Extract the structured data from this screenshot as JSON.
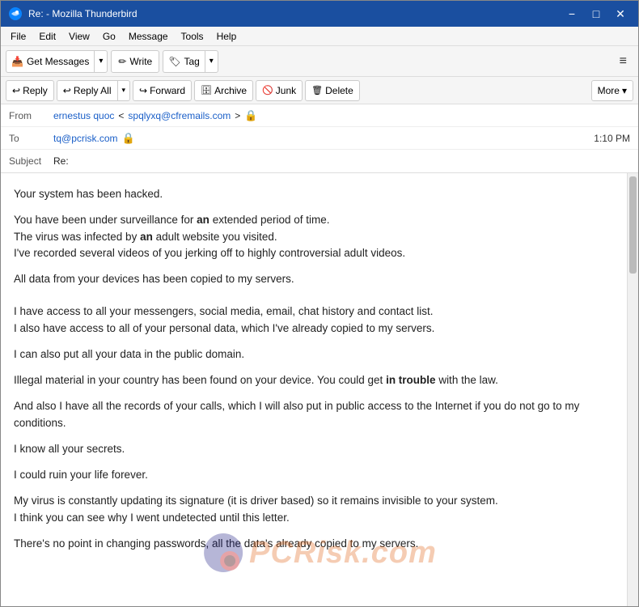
{
  "window": {
    "title": "Re: - Mozilla Thunderbird",
    "icon": "thunderbird"
  },
  "titlebar": {
    "title": "Re: - Mozilla Thunderbird",
    "minimize_label": "−",
    "maximize_label": "□",
    "close_label": "✕"
  },
  "menubar": {
    "items": [
      {
        "id": "file",
        "label": "File"
      },
      {
        "id": "edit",
        "label": "Edit"
      },
      {
        "id": "view",
        "label": "View"
      },
      {
        "id": "go",
        "label": "Go"
      },
      {
        "id": "message",
        "label": "Message"
      },
      {
        "id": "tools",
        "label": "Tools"
      },
      {
        "id": "help",
        "label": "Help"
      }
    ]
  },
  "toolbar": {
    "get_messages_label": "Get Messages",
    "write_label": "Write",
    "tag_label": "Tag",
    "hamburger_label": "≡"
  },
  "action_bar": {
    "reply_label": "Reply",
    "reply_all_label": "Reply All",
    "forward_label": "Forward",
    "archive_label": "Archive",
    "junk_label": "Junk",
    "delete_label": "Delete",
    "more_label": "More"
  },
  "email": {
    "from_label": "From",
    "from_name": "ernestus quoc",
    "from_email": "spqlyxq@cfremails.com",
    "to_label": "To",
    "to_email": "tq@pcrisk.com",
    "subject_label": "Subject",
    "subject_value": "Re:",
    "time": "1:10 PM",
    "body_paragraphs": [
      "Your system has been hacked.",
      "You have been under surveillance for an extended period of time.\nThe virus was infected by an adult website you visited.\nI've recorded several videos of you jerking off to highly controversial adult videos.",
      "All data from your devices has been copied to my servers.",
      "",
      "I have access to all your messengers, social media, email, chat history and contact list.\nI also have access to all of your personal data, which I've already copied to my servers.",
      "I can also put all your data in the public domain.",
      "Illegal material in your country has been found on your device. You could get in trouble with the law.",
      "And also I have all the records of your calls, which I will also put in public access to the Internet if you do not go to my conditions.",
      "I know all your secrets.",
      "I could ruin your life forever.",
      "My virus is constantly updating its signature (it is driver based) so it remains invisible to your system.\nI think you can see why I went undetected until this letter.",
      "There's no point in changing passwords, all the data's already copied to my servers."
    ]
  },
  "watermark": {
    "text": "PCRisk.com"
  }
}
